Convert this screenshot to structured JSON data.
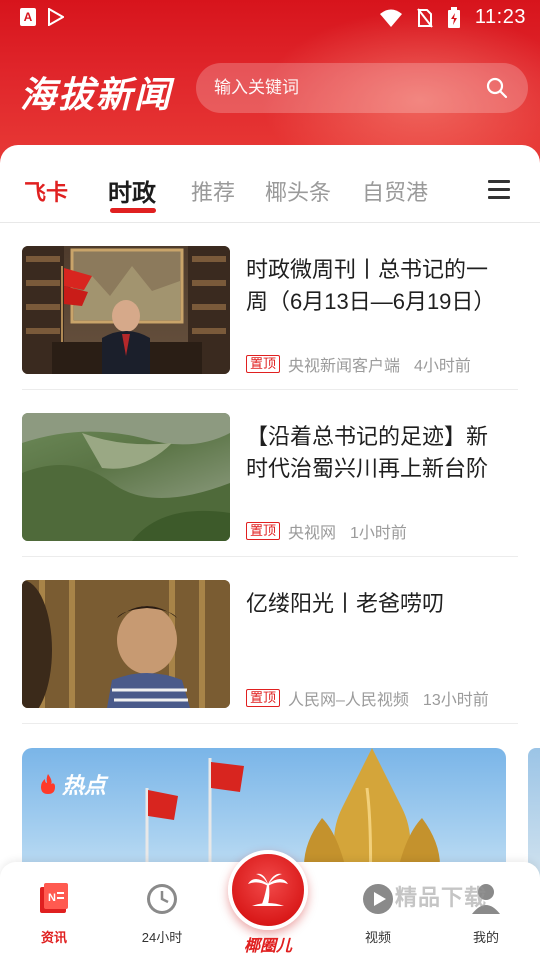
{
  "status_bar": {
    "time": "11:23",
    "left_icons": [
      "notification-a-icon",
      "play-store-icon"
    ]
  },
  "header": {
    "logo": "海拔新闻"
  },
  "search": {
    "placeholder": "输入关键词"
  },
  "tabs": [
    {
      "label": "飞卡"
    },
    {
      "label": "时政"
    },
    {
      "label": "推荐"
    },
    {
      "label": "椰头条"
    },
    {
      "label": "自贸港"
    }
  ],
  "news": [
    {
      "title": "时政微周刊丨总书记的一周（6月13日—6月19日）",
      "pin": "置顶",
      "source": "央视新闻客户端",
      "time": "4小时前"
    },
    {
      "title": "【沿着总书记的足迹】新时代治蜀兴川再上新台阶",
      "pin": "置顶",
      "source": "央视网",
      "time": "1小时前"
    },
    {
      "title": "亿缕阳光丨老爸唠叨",
      "pin": "置顶",
      "source": "人民网–人民视频",
      "time": "13小时前"
    }
  ],
  "hot_banner": {
    "label": "热点"
  },
  "bottom_nav": {
    "items": [
      {
        "label": "资讯"
      },
      {
        "label": "24小时"
      },
      {
        "label": "椰圈儿"
      },
      {
        "label": "视频"
      },
      {
        "label": "我的"
      }
    ]
  },
  "watermark": "精品下载",
  "colors": {
    "brand_red": "#e02020",
    "header_red": "#d7141c"
  }
}
